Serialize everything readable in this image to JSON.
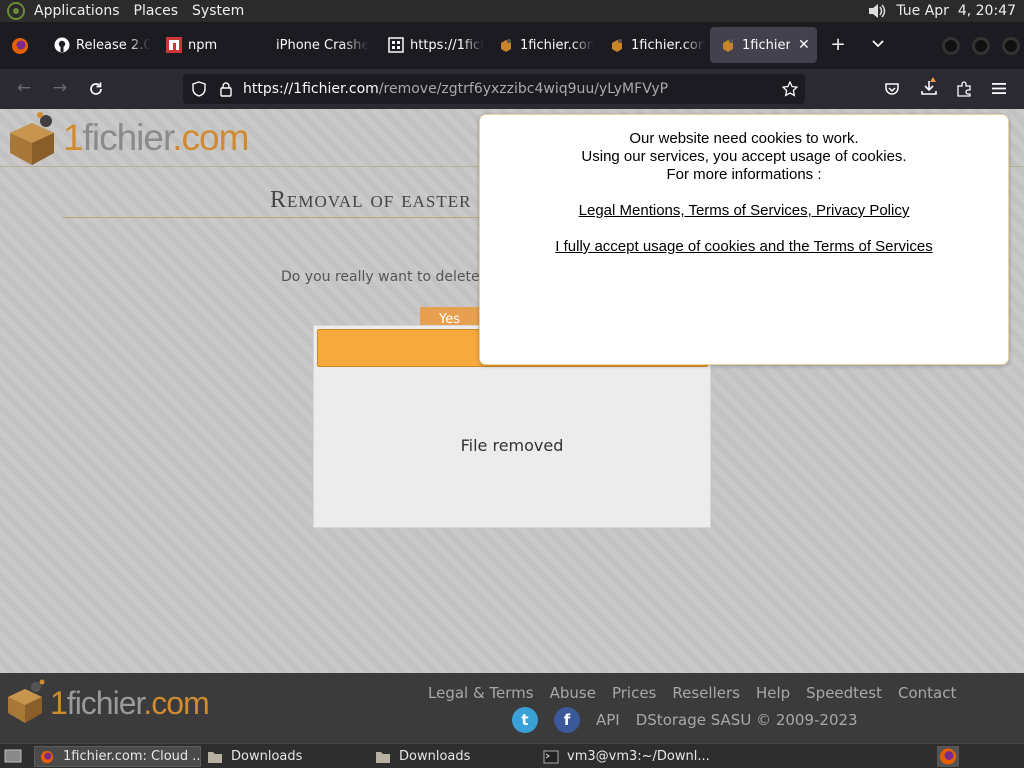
{
  "top_panel": {
    "menus": [
      "Applications",
      "Places",
      "System"
    ],
    "clock": "Tue Apr  4, 20:47"
  },
  "tabs": [
    {
      "label": "Release 2.0",
      "icon": "github-icon"
    },
    {
      "label": "npm",
      "icon": "npm-icon"
    },
    {
      "label": "iPhone Crashe",
      "icon": "none"
    },
    {
      "label": "https://1fich",
      "icon": "page-icon"
    },
    {
      "label": "1fichier.com",
      "icon": "1fichier-favicon"
    },
    {
      "label": "1fichier.com",
      "icon": "1fichier-favicon"
    },
    {
      "label": "1fichier.",
      "icon": "1fichier-favicon",
      "active": true
    }
  ],
  "nav": {
    "url_domain": "https://1fichier.com",
    "url_path": "/remove/zgtrf6yxzzibc4wiq9uu/yLyMFVyP"
  },
  "site": {
    "logo_num": "1",
    "logo_name": "fichier",
    "logo_tld": ".com",
    "page_title": "Removal of easter",
    "question": "Do you really want to delete th",
    "yes_button": "Yes"
  },
  "dialog": {
    "message": "File removed"
  },
  "cookie": {
    "line1": "Our website need cookies to work.",
    "line2": "Using our services, you accept usage of cookies.",
    "line3": "For more informations :",
    "legal_link": "Legal Mentions, Terms of Services, Privacy Policy",
    "accept_link": "I fully accept usage of cookies and the Terms of Services"
  },
  "footer": {
    "links": [
      "Legal & Terms",
      "Abuse",
      "Prices",
      "Resellers",
      "Help",
      "Speedtest",
      "Contact"
    ],
    "social": [
      {
        "icon": "twitter-icon",
        "color": "#3aa0d8"
      },
      {
        "icon": "facebook-icon",
        "color": "#3b5998"
      }
    ],
    "api": "API",
    "copyright": "DStorage SASU © 2009-2023"
  },
  "taskbar": {
    "items": [
      "1fichier.com: Cloud ...",
      "Downloads",
      "Downloads",
      "vm3@vm3:~/Downl..."
    ]
  },
  "colors": {
    "accent_orange": "#f6a93c",
    "brand_orange": "#d08a30"
  }
}
